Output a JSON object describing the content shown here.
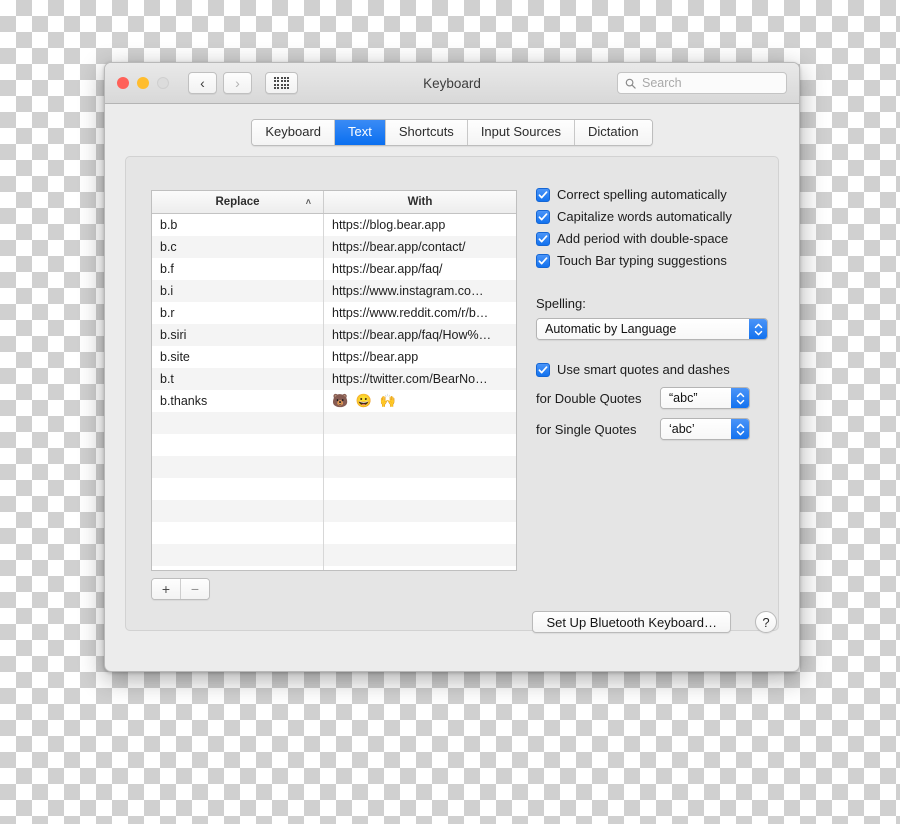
{
  "window": {
    "title": "Keyboard",
    "traffic_lights": [
      "close",
      "minimize",
      "zoom"
    ],
    "back_icon": "‹",
    "forward_icon": "›",
    "grid_icon": "grid-icon"
  },
  "search": {
    "placeholder": "Search",
    "icon": "search-icon"
  },
  "tabs": [
    {
      "label": "Keyboard",
      "active": false
    },
    {
      "label": "Text",
      "active": true
    },
    {
      "label": "Shortcuts",
      "active": false
    },
    {
      "label": "Input Sources",
      "active": false
    },
    {
      "label": "Dictation",
      "active": false
    }
  ],
  "table": {
    "columns": [
      "Replace",
      "With"
    ],
    "sort_column": "Replace",
    "sort_indicator": "˄",
    "rows": [
      {
        "replace": "b.b",
        "with": "https://blog.bear.app"
      },
      {
        "replace": "b.c",
        "with": "https://bear.app/contact/"
      },
      {
        "replace": "b.f",
        "with": "https://bear.app/faq/"
      },
      {
        "replace": "b.i",
        "with": "https://www.instagram.co…"
      },
      {
        "replace": "b.r",
        "with": "https://www.reddit.com/r/b…"
      },
      {
        "replace": "b.siri",
        "with": "https://bear.app/faq/How%…"
      },
      {
        "replace": "b.site",
        "with": "https://bear.app"
      },
      {
        "replace": "b.t",
        "with": "https://twitter.com/BearNo…"
      },
      {
        "replace": "b.thanks",
        "with": "🐻 😀 🙌"
      }
    ],
    "empty_row_count": 8
  },
  "list_controls": {
    "add_label": "+",
    "remove_label": "−"
  },
  "options": {
    "checkboxes": [
      {
        "label": "Correct spelling automatically",
        "checked": true
      },
      {
        "label": "Capitalize words automatically",
        "checked": true
      },
      {
        "label": "Add period with double-space",
        "checked": true
      },
      {
        "label": "Touch Bar typing suggestions",
        "checked": true
      }
    ],
    "spelling": {
      "label": "Spelling:",
      "value": "Automatic by Language"
    },
    "smart_quotes": {
      "label": "Use smart quotes and dashes",
      "checked": true,
      "double_quotes_label": "for Double Quotes",
      "double_quotes_value": "“abc”",
      "single_quotes_label": "for Single Quotes",
      "single_quotes_value": "‘abc’"
    }
  },
  "footer": {
    "bluetooth_button": "Set Up Bluetooth Keyboard…",
    "help_button": "?"
  },
  "colors": {
    "accent_blue": "#0a6ff0",
    "checkbox_blue": "#1272ef",
    "window_bg": "#ececec",
    "panel_bg": "#e5e5e5"
  }
}
